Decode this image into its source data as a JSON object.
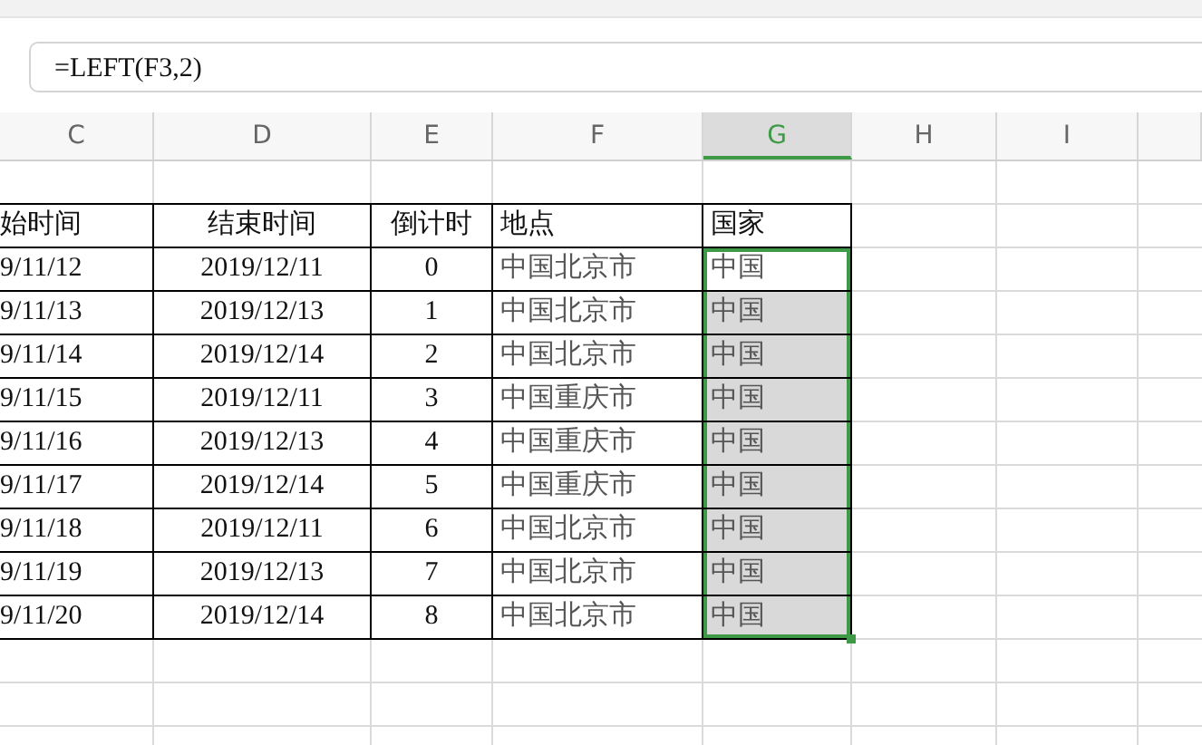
{
  "formula_bar": {
    "value": "=LEFT(F3,2)"
  },
  "column_headers": [
    {
      "label": "C",
      "selected": false
    },
    {
      "label": "D",
      "selected": false
    },
    {
      "label": "E",
      "selected": false
    },
    {
      "label": "F",
      "selected": false
    },
    {
      "label": "G",
      "selected": true
    },
    {
      "label": "H",
      "selected": false
    },
    {
      "label": "I",
      "selected": false
    }
  ],
  "table": {
    "columns": [
      "始时间",
      "结束时间",
      "倒计时",
      "地点",
      "国家"
    ],
    "rows": [
      {
        "cells": [
          "9/11/12",
          "2019/12/11",
          "0",
          "中国北京市",
          "中国"
        ],
        "selected": true,
        "active": true
      },
      {
        "cells": [
          "9/11/13",
          "2019/12/13",
          "1",
          "中国北京市",
          "中国"
        ],
        "selected": true,
        "active": false
      },
      {
        "cells": [
          "9/11/14",
          "2019/12/14",
          "2",
          "中国北京市",
          "中国"
        ],
        "selected": true,
        "active": false
      },
      {
        "cells": [
          "9/11/15",
          "2019/12/11",
          "3",
          "中国重庆市",
          "中国"
        ],
        "selected": true,
        "active": false
      },
      {
        "cells": [
          "9/11/16",
          "2019/12/13",
          "4",
          "中国重庆市",
          "中国"
        ],
        "selected": true,
        "active": false
      },
      {
        "cells": [
          "9/11/17",
          "2019/12/14",
          "5",
          "中国重庆市",
          "中国"
        ],
        "selected": true,
        "active": false
      },
      {
        "cells": [
          "9/11/18",
          "2019/12/11",
          "6",
          "中国北京市",
          "中国"
        ],
        "selected": true,
        "active": false
      },
      {
        "cells": [
          "9/11/19",
          "2019/12/13",
          "7",
          "中国北京市",
          "中国"
        ],
        "selected": true,
        "active": false
      },
      {
        "cells": [
          "9/11/20",
          "2019/12/14",
          "8",
          "中国北京市",
          "中国"
        ],
        "selected": true,
        "active": false
      }
    ]
  }
}
